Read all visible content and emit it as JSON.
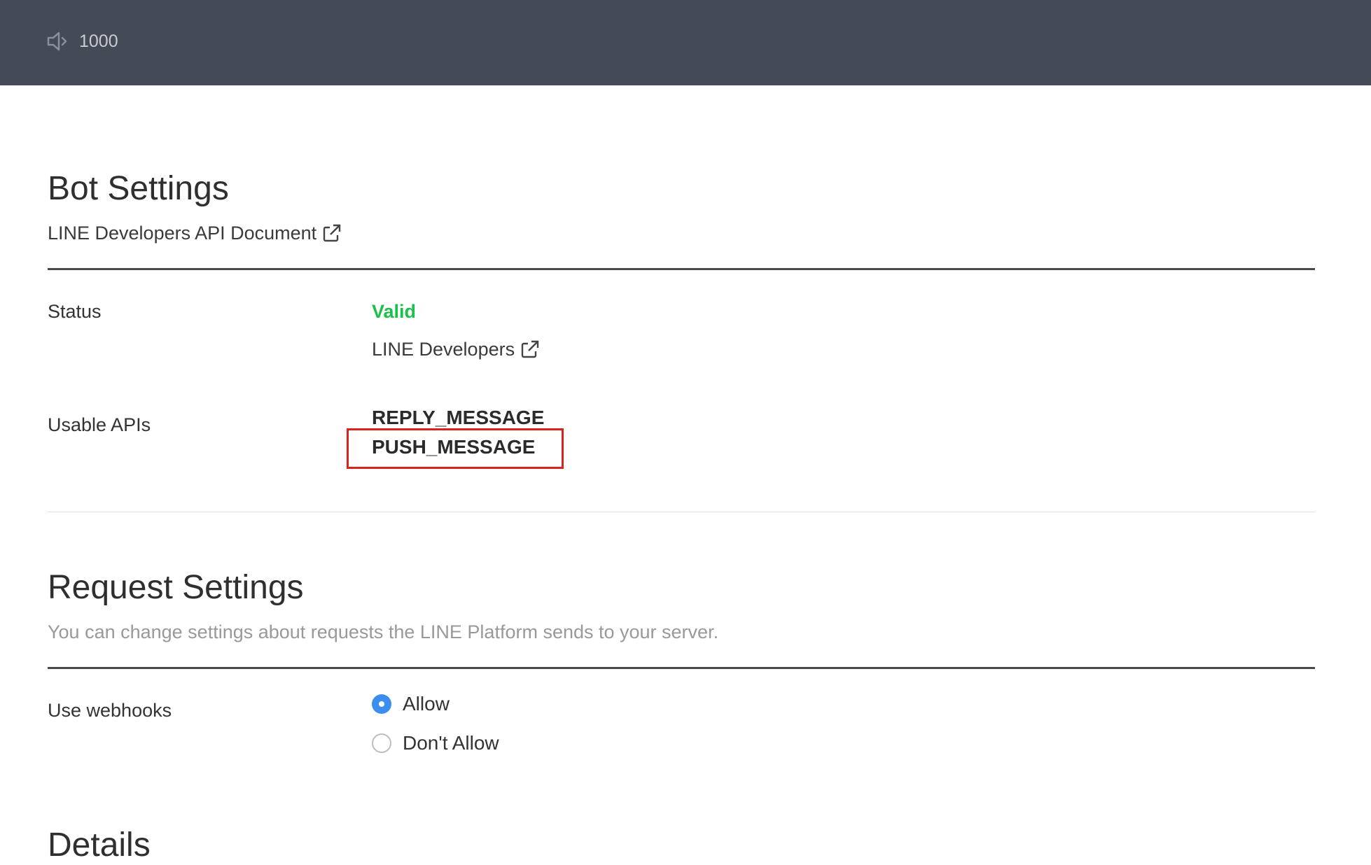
{
  "topbar": {
    "icon": "speaker-icon",
    "count": "1000"
  },
  "bot_settings": {
    "title": "Bot Settings",
    "doc_link_label": "LINE Developers API Document",
    "rows": {
      "status": {
        "label": "Status",
        "value": "Valid",
        "value_color": "#1bbf4a",
        "link_label": "LINE Developers"
      },
      "usable_apis": {
        "label": "Usable APIs",
        "items": [
          "REPLY_MESSAGE",
          "PUSH_MESSAGE"
        ],
        "highlighted_item": "PUSH_MESSAGE",
        "highlight_color": "#d9231c"
      }
    }
  },
  "request_settings": {
    "title": "Request Settings",
    "description": "You can change settings about requests the LINE Platform sends to your server.",
    "use_webhooks": {
      "label": "Use webhooks",
      "options": [
        {
          "label": "Allow",
          "selected": true
        },
        {
          "label": "Don't Allow",
          "selected": false
        }
      ]
    }
  },
  "details": {
    "title": "Details"
  },
  "colors": {
    "header_bg": "#444a56",
    "radio_accent": "#3b8ef0"
  }
}
